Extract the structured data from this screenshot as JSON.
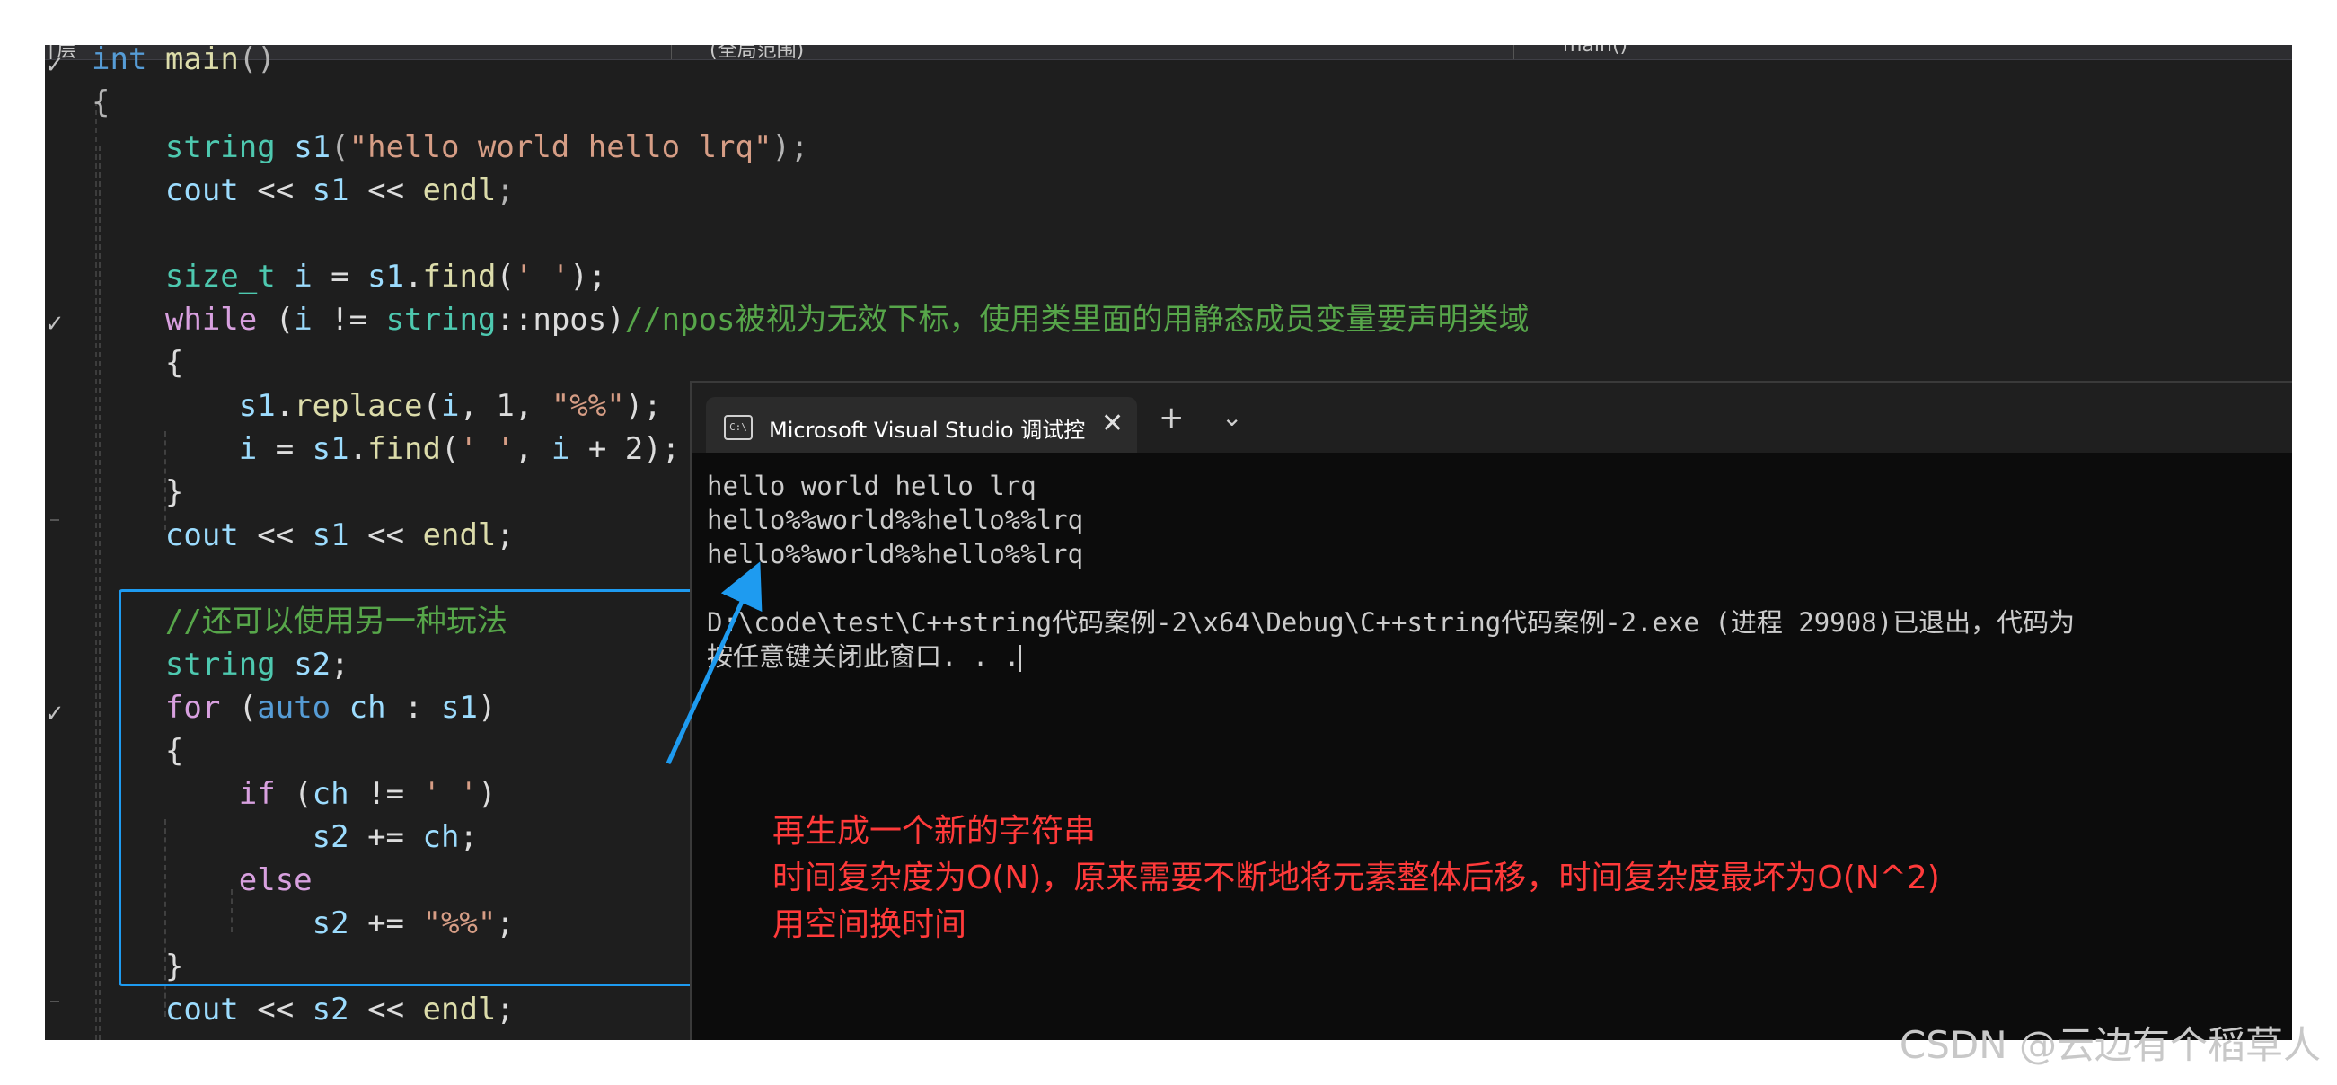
{
  "navbar": {
    "left": "│层",
    "scope": "(全局范围)",
    "function": "main()"
  },
  "code": [
    [
      {
        "t": "int",
        "c": "kw"
      },
      {
        "t": " "
      },
      {
        "t": "main",
        "c": "fn"
      },
      {
        "t": "()",
        "c": "pu"
      }
    ],
    [
      {
        "t": "{",
        "c": "pu"
      }
    ],
    [
      {
        "t": "    "
      },
      {
        "t": "string",
        "c": "ty"
      },
      {
        "t": " "
      },
      {
        "t": "s1",
        "c": "var"
      },
      {
        "t": "(",
        "c": "pu"
      },
      {
        "t": "\"hello world hello lrq\"",
        "c": "str"
      },
      {
        "t": ");",
        "c": "pu"
      }
    ],
    [
      {
        "t": "    "
      },
      {
        "t": "cout",
        "c": "var"
      },
      {
        "t": " << "
      },
      {
        "t": "s1",
        "c": "var"
      },
      {
        "t": " << "
      },
      {
        "t": "endl",
        "c": "fn"
      },
      {
        "t": ";",
        "c": "pu"
      }
    ],
    [],
    [
      {
        "t": "    "
      },
      {
        "t": "size_t",
        "c": "ty"
      },
      {
        "t": " "
      },
      {
        "t": "i",
        "c": "var"
      },
      {
        "t": " = "
      },
      {
        "t": "s1",
        "c": "var"
      },
      {
        "t": "."
      },
      {
        "t": "find",
        "c": "fn"
      },
      {
        "t": "("
      },
      {
        "t": "' '",
        "c": "str"
      },
      {
        "t": ");"
      }
    ],
    [
      {
        "t": "    "
      },
      {
        "t": "while",
        "c": "ct"
      },
      {
        "t": " ("
      },
      {
        "t": "i",
        "c": "var"
      },
      {
        "t": " != "
      },
      {
        "t": "string",
        "c": "ty"
      },
      {
        "t": "::npos)"
      },
      {
        "t": "//npos被视为无效下标，使用类里面的用静态成员变量要声明类域",
        "c": "cm"
      }
    ],
    [
      {
        "t": "    {"
      }
    ],
    [
      {
        "t": "        "
      },
      {
        "t": "s1",
        "c": "var"
      },
      {
        "t": "."
      },
      {
        "t": "replace",
        "c": "fn"
      },
      {
        "t": "("
      },
      {
        "t": "i",
        "c": "var"
      },
      {
        "t": ", 1, "
      },
      {
        "t": "\"%%\"",
        "c": "str"
      },
      {
        "t": ");"
      }
    ],
    [
      {
        "t": "        "
      },
      {
        "t": "i",
        "c": "var"
      },
      {
        "t": " = "
      },
      {
        "t": "s1",
        "c": "var"
      },
      {
        "t": "."
      },
      {
        "t": "find",
        "c": "fn"
      },
      {
        "t": "("
      },
      {
        "t": "' '",
        "c": "str"
      },
      {
        "t": ", "
      },
      {
        "t": "i",
        "c": "var"
      },
      {
        "t": " + 2);"
      }
    ],
    [
      {
        "t": "    }"
      }
    ],
    [
      {
        "t": "    "
      },
      {
        "t": "cout",
        "c": "var"
      },
      {
        "t": " << "
      },
      {
        "t": "s1",
        "c": "var"
      },
      {
        "t": " << "
      },
      {
        "t": "endl",
        "c": "fn"
      },
      {
        "t": ";"
      }
    ],
    [],
    [
      {
        "t": "    "
      },
      {
        "t": "//还可以使用另一种玩法",
        "c": "cm"
      }
    ],
    [
      {
        "t": "    "
      },
      {
        "t": "string",
        "c": "ty"
      },
      {
        "t": " "
      },
      {
        "t": "s2",
        "c": "var"
      },
      {
        "t": ";"
      }
    ],
    [
      {
        "t": "    "
      },
      {
        "t": "for",
        "c": "ct"
      },
      {
        "t": " ("
      },
      {
        "t": "auto",
        "c": "kw"
      },
      {
        "t": " "
      },
      {
        "t": "ch",
        "c": "var"
      },
      {
        "t": " : "
      },
      {
        "t": "s1",
        "c": "var"
      },
      {
        "t": ")"
      }
    ],
    [
      {
        "t": "    {"
      }
    ],
    [
      {
        "t": "        "
      },
      {
        "t": "if",
        "c": "ct"
      },
      {
        "t": " ("
      },
      {
        "t": "ch",
        "c": "var"
      },
      {
        "t": " != "
      },
      {
        "t": "' '",
        "c": "str"
      },
      {
        "t": ")"
      }
    ],
    [
      {
        "t": "            "
      },
      {
        "t": "s2",
        "c": "var"
      },
      {
        "t": " += "
      },
      {
        "t": "ch",
        "c": "var"
      },
      {
        "t": ";"
      }
    ],
    [
      {
        "t": "        "
      },
      {
        "t": "else",
        "c": "ct"
      }
    ],
    [
      {
        "t": "            "
      },
      {
        "t": "s2",
        "c": "var"
      },
      {
        "t": " += "
      },
      {
        "t": "\"%%\"",
        "c": "str"
      },
      {
        "t": ";"
      }
    ],
    [
      {
        "t": "    }"
      }
    ],
    [
      {
        "t": "    "
      },
      {
        "t": "cout",
        "c": "var"
      },
      {
        "t": " << "
      },
      {
        "t": "s2",
        "c": "var"
      },
      {
        "t": " << "
      },
      {
        "t": "endl",
        "c": "fn"
      },
      {
        "t": ";"
      }
    ]
  ],
  "console": {
    "tab_title": "Microsoft Visual Studio 调试控",
    "icon_label": "C:\\",
    "close": "✕",
    "plus": "+",
    "chevron": "⌄",
    "lines": [
      "hello world hello lrq",
      "hello%%world%%hello%%lrq",
      "hello%%world%%hello%%lrq",
      "",
      "D:\\code\\test\\C++string代码案例-2\\x64\\Debug\\C++string代码案例-2.exe (进程 29908)已退出，代码为",
      "按任意键关闭此窗口. . ."
    ]
  },
  "annotation": [
    "再生成一个新的字符串",
    "时间复杂度为O(N)，原来需要不断地将元素整体后移，时间复杂度最坏为O(N^2)",
    "用空间换时间"
  ],
  "watermark": "CSDN @云边有个稻草人",
  "colors": {
    "highlight_box": "#1e9bf0",
    "annotation": "#ff3a3a",
    "arrow": "#1e9bf0"
  }
}
